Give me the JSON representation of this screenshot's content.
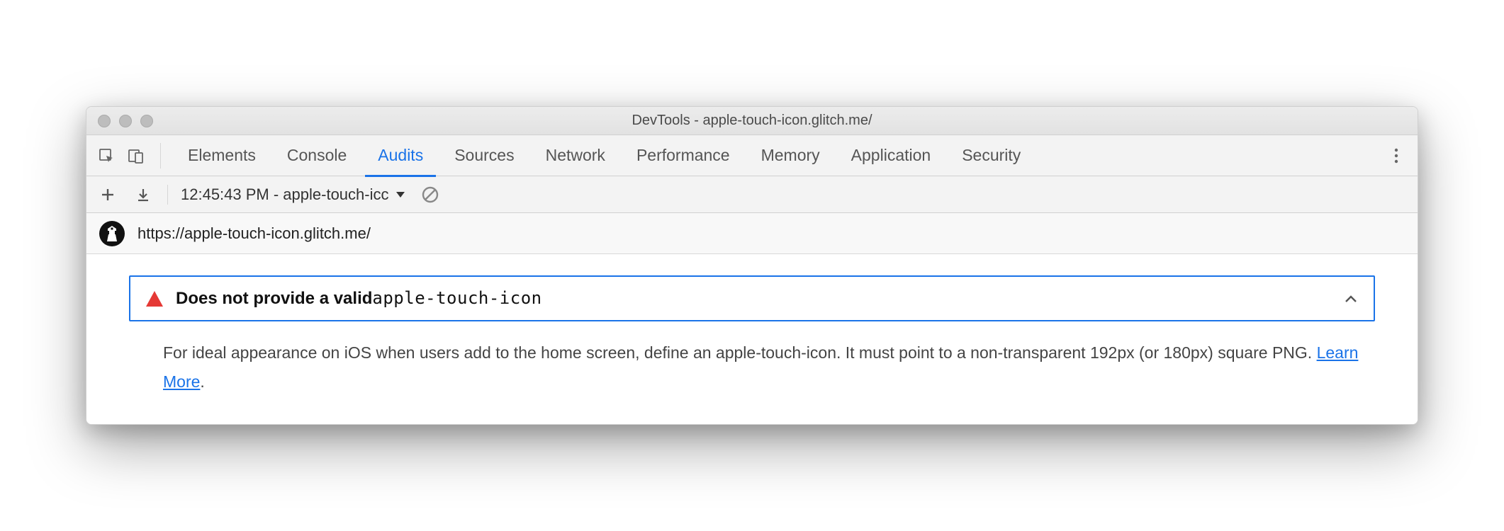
{
  "window": {
    "title": "DevTools - apple-touch-icon.glitch.me/"
  },
  "tabs": [
    {
      "label": "Elements",
      "active": false
    },
    {
      "label": "Console",
      "active": false
    },
    {
      "label": "Audits",
      "active": true
    },
    {
      "label": "Sources",
      "active": false
    },
    {
      "label": "Network",
      "active": false
    },
    {
      "label": "Performance",
      "active": false
    },
    {
      "label": "Memory",
      "active": false
    },
    {
      "label": "Application",
      "active": false
    },
    {
      "label": "Security",
      "active": false
    }
  ],
  "toolbar": {
    "run_dropdown": "12:45:43 PM - apple-touch-icc"
  },
  "url": "https://apple-touch-icon.glitch.me/",
  "audit": {
    "title_lead": "Does not provide a valid ",
    "title_code": "apple-touch-icon",
    "description_before_link": "For ideal appearance on iOS when users add to the home screen, define an apple-touch-icon. It must point to a non-transparent 192px (or 180px) square PNG. ",
    "link_text": "Learn More",
    "description_after_link": "."
  }
}
